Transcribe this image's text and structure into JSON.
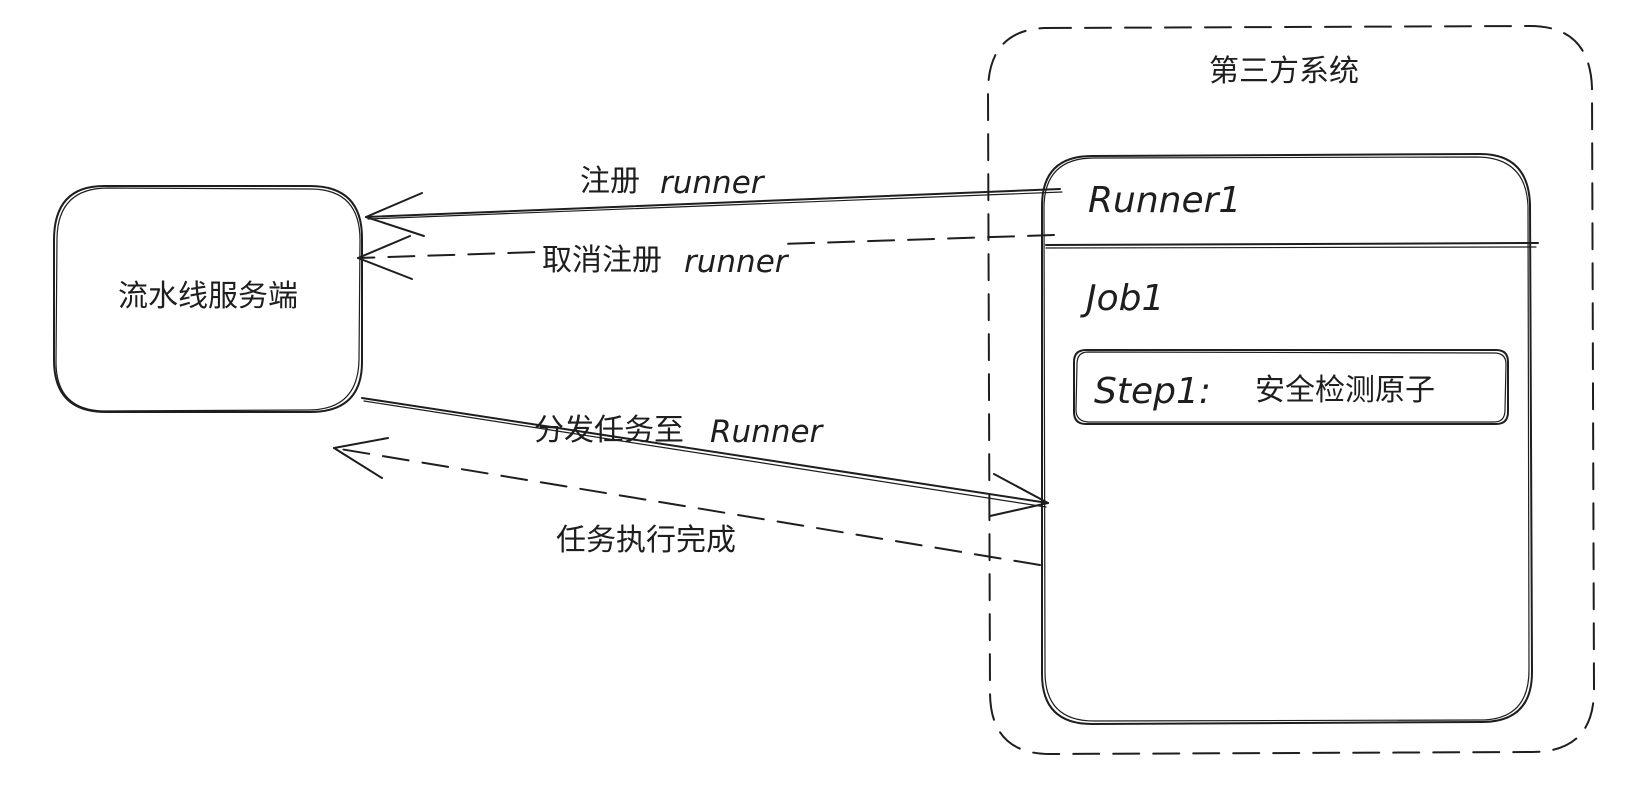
{
  "nodes": {
    "server": {
      "label": "流水线服务端"
    },
    "third_party": {
      "label": "第三方系统"
    },
    "runner": {
      "title": "Runner1"
    },
    "job": {
      "title": "Job1"
    },
    "step": {
      "name": "Step1:",
      "label": "安全检测原子"
    }
  },
  "edges": {
    "register": {
      "label": "注册 runner",
      "style": "solid",
      "direction": "runner-to-server"
    },
    "unregister": {
      "label": "取消注册 runner",
      "style": "dashed",
      "direction": "runner-to-server"
    },
    "dispatch": {
      "label": "分发任务至 Runner",
      "style": "solid",
      "direction": "server-to-runner"
    },
    "complete": {
      "label": "任务执行完成",
      "style": "dashed",
      "direction": "runner-to-server"
    }
  },
  "colors": {
    "stroke": "#1e1e1e",
    "background": "#ffffff"
  }
}
